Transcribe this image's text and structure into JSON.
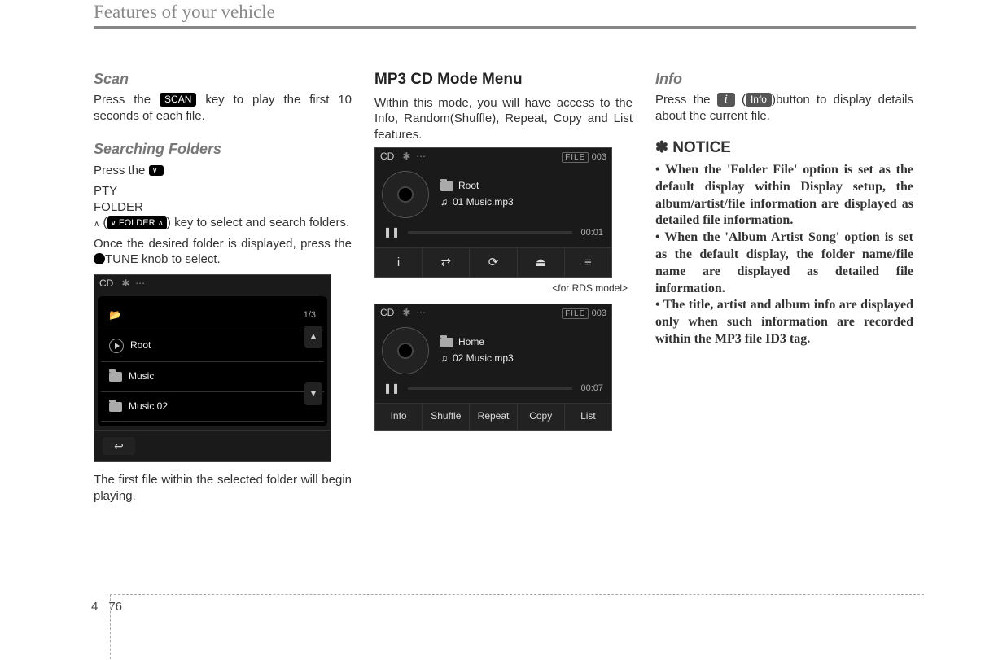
{
  "header": "Features of your vehicle",
  "footer": {
    "section": "4",
    "page": "76"
  },
  "col1": {
    "scan": {
      "title": "Scan",
      "before": "Press the ",
      "key": "SCAN",
      "after": " key to play the first 10 seconds of each file."
    },
    "searching": {
      "title": "Searching Folders",
      "before": "Press the ",
      "pty_top": "PTY",
      "pty_bottom": "FOLDER",
      "folder_key": "FOLDER",
      "after": "key to select and search folders.",
      "line2_before": "Once the desired folder is displayed, press the ",
      "line2_after": "TUNE knob to select."
    },
    "screen": {
      "source": "CD",
      "counter": "1/3",
      "rows": [
        "Root",
        "Music",
        "Music 02"
      ]
    },
    "after_screen": "The first file within the selected folder will begin playing."
  },
  "col2": {
    "title": "MP3 CD Mode Menu",
    "intro": "Within this mode, you will have access to the Info, Random(Shuffle), Repeat, Copy and List features.",
    "screenA": {
      "source": "CD",
      "file_badge": "FILE",
      "file_num": "003",
      "folder": "Root",
      "track": "01 Music.mp3",
      "time": "00:01",
      "menu_icons": [
        "i",
        "⇄",
        "⟳",
        "⏏",
        "≡"
      ]
    },
    "caption": "<for RDS model>",
    "screenB": {
      "source": "CD",
      "file_badge": "FILE",
      "file_num": "003",
      "folder": "Home",
      "track": "02 Music.mp3",
      "time": "00:07",
      "menu_labels": [
        "Info",
        "Shuffle",
        "Repeat",
        "Copy",
        "List"
      ]
    }
  },
  "col3": {
    "info": {
      "title": "Info",
      "before": "Press the ",
      "icon": "i",
      "key": "Info",
      "after": "button to display details about the current file."
    },
    "notice": {
      "heading": "✽ NOTICE",
      "bullets": [
        "When the 'Folder File' option is set as the default display within Display setup, the album/artist/file information are displayed as detailed file information.",
        "When the 'Album Artist Song' option is set as the default display, the folder name/file name are displayed as detailed file information.",
        "The title, artist and album info are displayed only when such information are recorded within the MP3 file ID3 tag."
      ]
    }
  }
}
